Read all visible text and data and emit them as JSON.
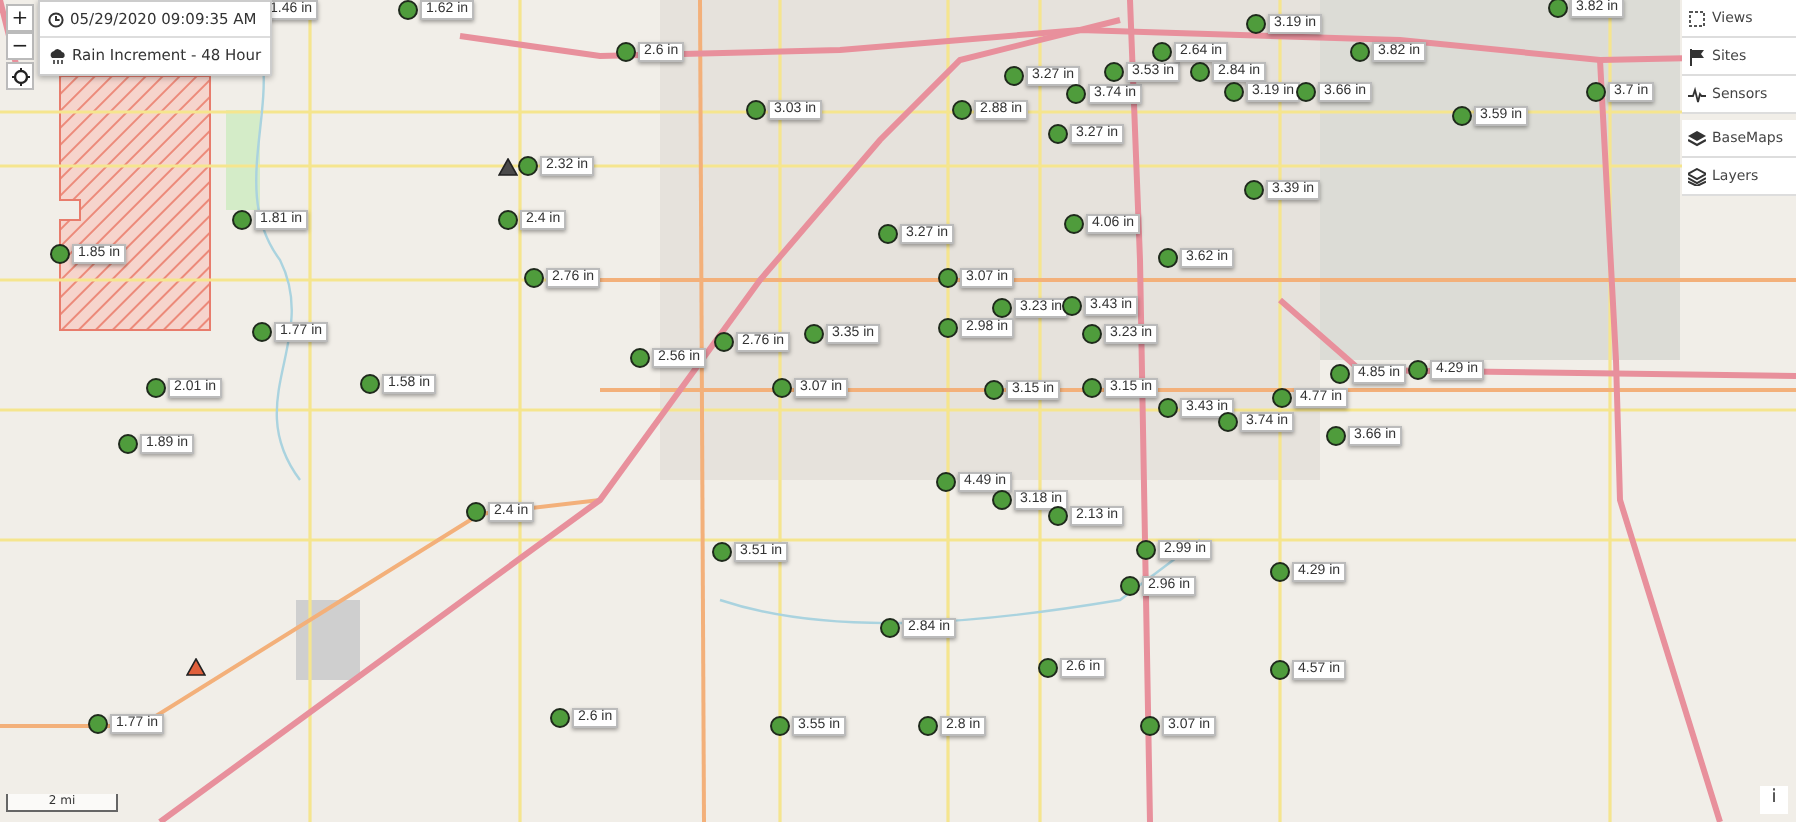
{
  "zoom_controls": {
    "zoom_in": "+",
    "zoom_out": "−"
  },
  "info_panel": {
    "timestamp": "05/29/2020 09:09:35 AM",
    "layer": "Rain Increment - 48 Hour"
  },
  "menu": [
    {
      "label": "Views",
      "kind": "views"
    },
    {
      "label": "Sites",
      "kind": "sites"
    },
    {
      "label": "Sensors",
      "kind": "sensors"
    },
    {
      "label": "BaseMaps",
      "kind": "basemaps"
    },
    {
      "label": "Layers",
      "kind": "layers"
    }
  ],
  "alerts": [
    {
      "color": "#4a4a4a"
    },
    {
      "color": "#e0603c"
    }
  ],
  "markers": [
    {
      "label": "1.46 in"
    },
    {
      "label": "1.62 in"
    },
    {
      "label": "2.32 in"
    },
    {
      "label": "2.6 in"
    },
    {
      "label": "3.03 in"
    },
    {
      "label": "1.81 in"
    },
    {
      "label": "1.85 in"
    },
    {
      "label": "2.4 in"
    },
    {
      "label": "2.76 in"
    },
    {
      "label": "1.77 in"
    },
    {
      "label": "2.01 in"
    },
    {
      "label": "1.58 in"
    },
    {
      "label": "1.89 in"
    },
    {
      "label": "2.88 in"
    },
    {
      "label": "3.27 in"
    },
    {
      "label": "3.74 in"
    },
    {
      "label": "3.53 in"
    },
    {
      "label": "2.64 in"
    },
    {
      "label": "3.27 in"
    },
    {
      "label": "3.27 in"
    },
    {
      "label": "4.06 in"
    },
    {
      "label": "3.07 in"
    },
    {
      "label": "3.23 in"
    },
    {
      "label": "3.43 in"
    },
    {
      "label": "2.98 in"
    },
    {
      "label": "3.35 in"
    },
    {
      "label": "3.23 in"
    },
    {
      "label": "2.76 in"
    },
    {
      "label": "2.56 in"
    },
    {
      "label": "3.07 in"
    },
    {
      "label": "3.15 in"
    },
    {
      "label": "3.15 in"
    },
    {
      "label": "3.43 in"
    },
    {
      "label": "3.19 in"
    },
    {
      "label": "3.82 in"
    },
    {
      "label": "2.84 in"
    },
    {
      "label": "3.19 in"
    },
    {
      "label": "3.66 in"
    },
    {
      "label": "3.59 in"
    },
    {
      "label": "3.82 in"
    },
    {
      "label": "3.7 in"
    },
    {
      "label": "3.39 in"
    },
    {
      "label": "3.62 in"
    },
    {
      "label": "4.85 in"
    },
    {
      "label": "4.29 in"
    },
    {
      "label": "4.77 in"
    },
    {
      "label": "3.74 in"
    },
    {
      "label": "3.66 in"
    },
    {
      "label": "3.51 in"
    },
    {
      "label": "2.4 in"
    },
    {
      "label": "4.49 in"
    },
    {
      "label": "3.18 in"
    },
    {
      "label": "2.13 in"
    },
    {
      "label": "2.99 in"
    },
    {
      "label": "2.96 in"
    },
    {
      "label": "2.84 in"
    },
    {
      "label": "2.6 in"
    },
    {
      "label": "4.29 in"
    },
    {
      "label": "4.57 in"
    },
    {
      "label": "1.77 in"
    },
    {
      "label": "2.6 in"
    },
    {
      "label": "3.55 in"
    },
    {
      "label": "2.8 in"
    },
    {
      "label": "3.07 in"
    }
  ],
  "scale_bar": "2 mi",
  "info_button": "i"
}
